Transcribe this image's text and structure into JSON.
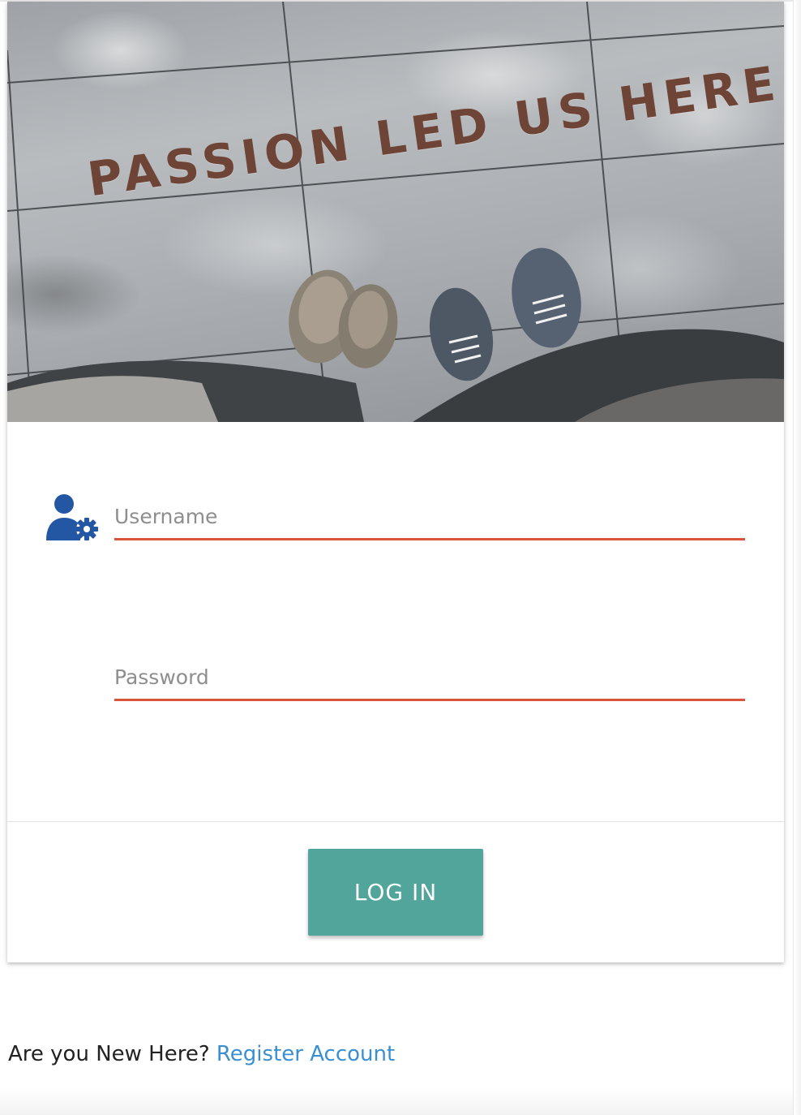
{
  "hero": {
    "image_text": "PASSION LED US HERE"
  },
  "form": {
    "username_placeholder": "Username",
    "password_placeholder": "Password",
    "username_value": "",
    "password_value": ""
  },
  "actions": {
    "login_label": "LOG IN"
  },
  "footer": {
    "prompt": "Are you New Here?",
    "register_link": "Register Account"
  },
  "colors": {
    "accent_underline": "#d9533d",
    "button_bg": "#52a59a",
    "link": "#3b8fd0",
    "icon": "#2457a3"
  },
  "icons": {
    "user_settings": "user-gear-icon"
  }
}
